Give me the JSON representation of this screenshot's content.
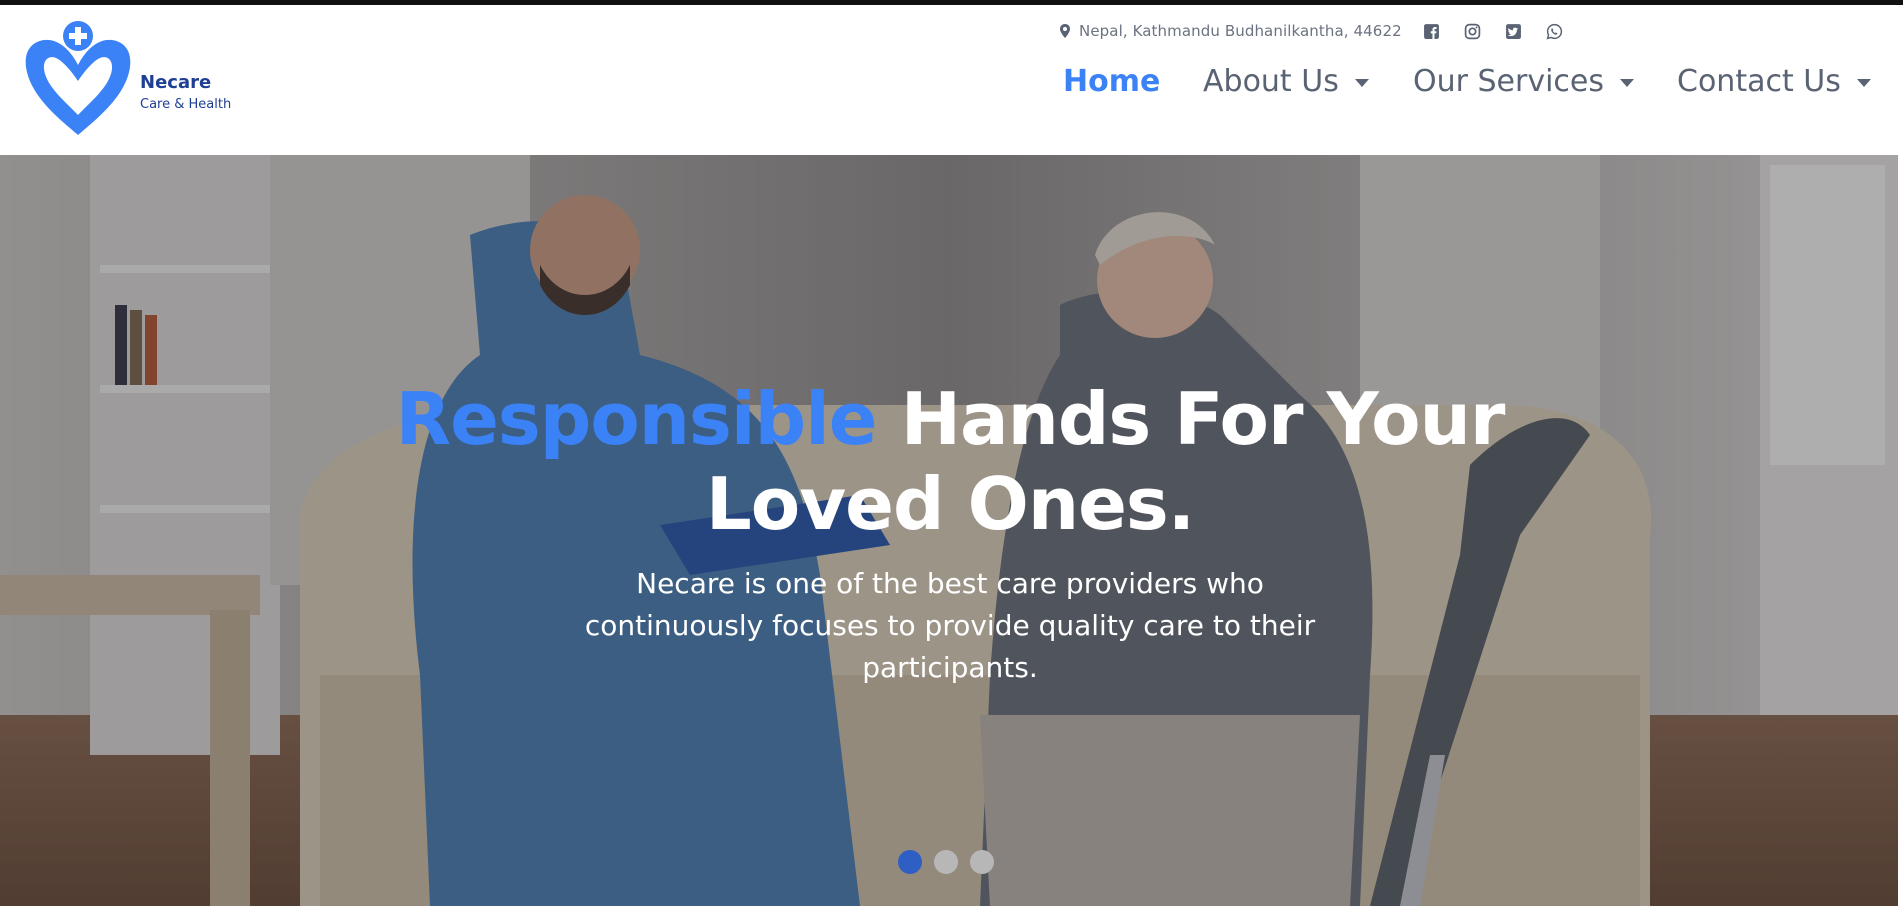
{
  "brand": {
    "name": "Necare",
    "tagline": "Care & Health",
    "color": "#1f3f94",
    "logo_color": "#3b82f6"
  },
  "topbar": {
    "address": "Nepal, Kathmandu Budhanilkantha, 44622",
    "social_icons": [
      "facebook-icon",
      "instagram-icon",
      "twitter-icon",
      "whatsapp-icon"
    ]
  },
  "nav": {
    "items": [
      {
        "label": "Home",
        "active": true,
        "dropdown": false
      },
      {
        "label": "About Us",
        "active": false,
        "dropdown": true
      },
      {
        "label": "Our Services",
        "active": false,
        "dropdown": true
      },
      {
        "label": "Contact Us",
        "active": false,
        "dropdown": true
      }
    ],
    "active_color": "#3b82f6",
    "underline_color": "#11c6e6"
  },
  "hero": {
    "title_accent": "Responsible",
    "title_rest_line1": "Hands For Your",
    "title_line2": "Loved Ones.",
    "subtitle": "Necare is one of the best care providers who continuously focuses to provide quality care to their participants.",
    "slides": 3,
    "active_slide": 1
  }
}
